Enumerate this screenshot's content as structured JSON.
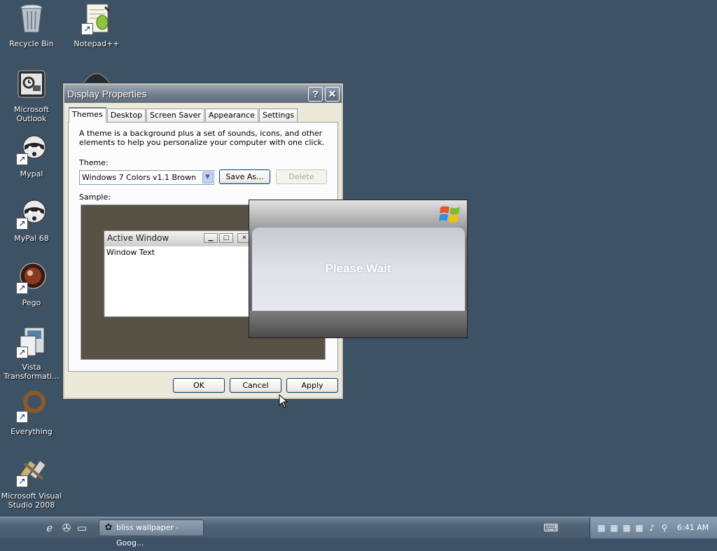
{
  "desktop": {
    "icons": [
      {
        "label": "Recycle Bin",
        "icon": "recycle-bin-icon"
      },
      {
        "label": "Notepad++",
        "icon": "notepad-plus-plus-icon"
      },
      {
        "label": "Microsoft Outlook",
        "icon": "outlook-icon"
      },
      {
        "label": "Mypal",
        "icon": "mypal-icon"
      },
      {
        "label": "MyPal 68",
        "icon": "mypal-68-icon"
      },
      {
        "label": "Pego",
        "icon": "pego-icon"
      },
      {
        "label": "Vista Transformati...",
        "icon": "vista-transformation-icon"
      },
      {
        "label": "Everything",
        "icon": "everything-icon"
      },
      {
        "label": "Microsoft Visual Studio 2008",
        "icon": "visual-studio-icon"
      }
    ]
  },
  "display_properties": {
    "title": "Display Properties",
    "help_glyph": "?",
    "close_glyph": "✕",
    "tabs": [
      {
        "label": "Themes",
        "active": true
      },
      {
        "label": "Desktop"
      },
      {
        "label": "Screen Saver"
      },
      {
        "label": "Appearance"
      },
      {
        "label": "Settings"
      }
    ],
    "description": "A theme is a background plus a set of sounds, icons, and other elements to help you personalize your computer with one click.",
    "theme_label": "Theme:",
    "theme_value": "Windows 7 Colors v1.1 Brown",
    "save_as_label": "Save As...",
    "delete_label": "Delete",
    "sample_label": "Sample:",
    "sample": {
      "active_window_title": "Active Window",
      "window_text": "Window Text",
      "min_glyph": "▁",
      "max_glyph": "□",
      "close_glyph": "✕"
    },
    "ok_label": "OK",
    "cancel_label": "Cancel",
    "apply_label": "Apply"
  },
  "please_wait": {
    "text": "Please Wait"
  },
  "taskbar": {
    "quick_launch": [
      "internet-explorer-icon",
      "show-desktop-icon",
      "window-switcher-icon"
    ],
    "task_button_label": "bliss wallpaper - Goog...",
    "clock": "6:41 AM",
    "colors": {
      "desktop": "#3e5266",
      "taskbar": "#4f6274"
    }
  }
}
